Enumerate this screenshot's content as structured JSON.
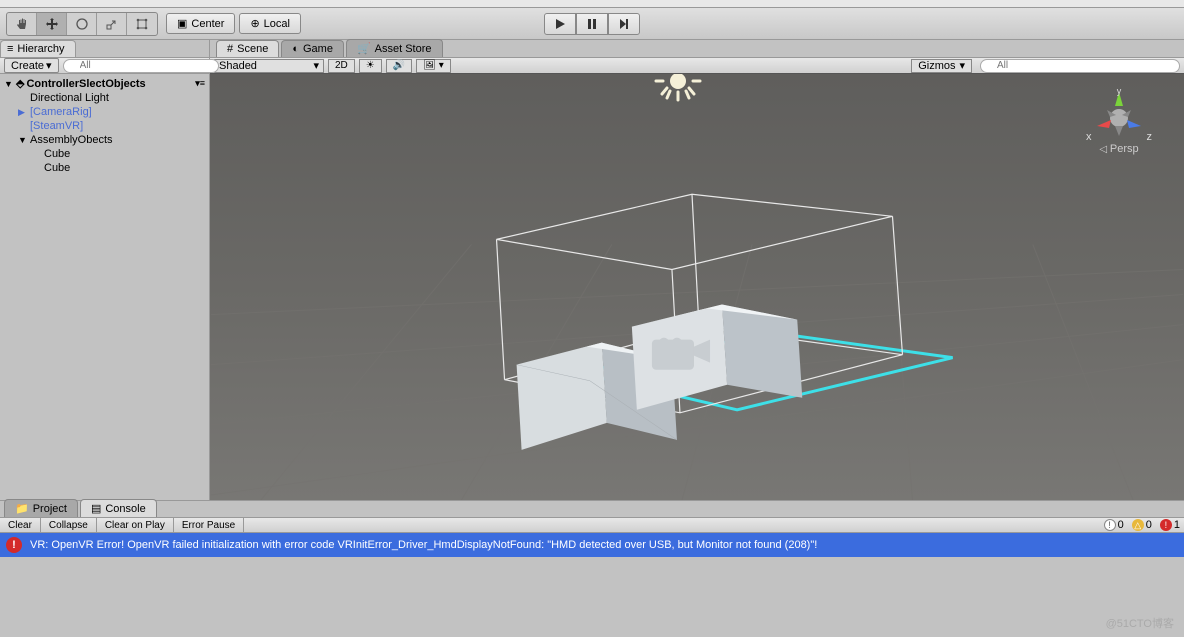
{
  "toolbar": {
    "center_label": "Center",
    "local_label": "Local"
  },
  "hierarchy": {
    "tab_label": "Hierarchy",
    "create_label": "Create",
    "search_placeholder": "All",
    "scene_name": "ControllerSlectObjects",
    "items": [
      {
        "label": "Directional Light",
        "indent": 1,
        "blue": false,
        "arrow": ""
      },
      {
        "label": "[CameraRig]",
        "indent": 1,
        "blue": true,
        "arrow": "▶"
      },
      {
        "label": "[SteamVR]",
        "indent": 1,
        "blue": true,
        "arrow": ""
      },
      {
        "label": "AssemblyObects",
        "indent": 1,
        "blue": false,
        "arrow": "▼"
      },
      {
        "label": "Cube",
        "indent": 2,
        "blue": false,
        "arrow": ""
      },
      {
        "label": "Cube",
        "indent": 2,
        "blue": false,
        "arrow": ""
      }
    ]
  },
  "scene_tabs": {
    "scene": "Scene",
    "game": "Game",
    "asset_store": "Asset Store"
  },
  "scene_toolbar": {
    "shaded": "Shaded",
    "mode_2d": "2D",
    "gizmos": "Gizmos",
    "search_placeholder": "All"
  },
  "scene_gizmo": {
    "x": "x",
    "y": "y",
    "z": "z",
    "persp": "Persp"
  },
  "bottom": {
    "project_tab": "Project",
    "console_tab": "Console",
    "clear": "Clear",
    "collapse": "Collapse",
    "clear_on_play": "Clear on Play",
    "error_pause": "Error Pause",
    "info_count": "0",
    "warn_count": "0",
    "error_count": "1",
    "error_msg": "VR: OpenVR Error! OpenVR failed initialization with error code VRInitError_Driver_HmdDisplayNotFound: \"HMD detected over USB, but Monitor not found (208)\"!"
  },
  "watermark": "@51CTO博客"
}
